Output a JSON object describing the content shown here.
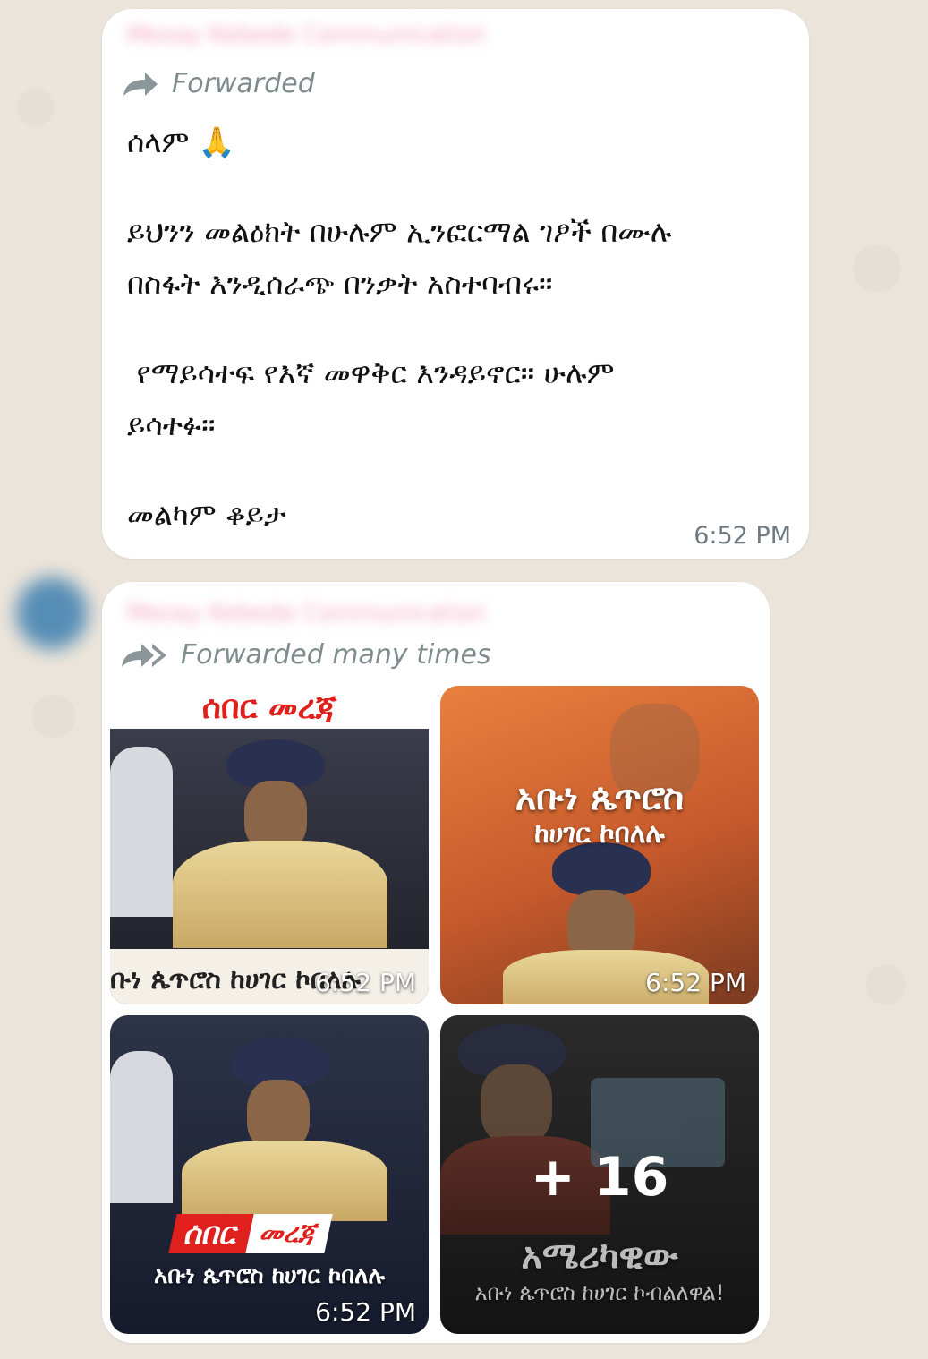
{
  "message1": {
    "sender": "Mesay Kebede Communication",
    "forwarded_label": "Forwarded",
    "greeting": "ሰላም 🙏",
    "para1_line1": "ይህንን መልዕክት በሁሉም ኢንፎርማል ገፆች በሙሉ",
    "para1_line2": "በስፋት እንዲሰራጭ በንቃት አስተባብሩ።",
    "para2_line1": " የማይሳተፍ የእኛ መዋቅር እንዳይኖር። ሁሉም",
    "para2_line2": "ይሳተፉ።",
    "closing": "መልካም ቆይታ",
    "time": "6:52 PM"
  },
  "message2": {
    "sender": "Mesay Kebede Communication",
    "forwarded_label": "Forwarded many times",
    "images": [
      {
        "headline": "ሰበር መረጃ",
        "caption": "ቡነ ጴጥሮስ ከሀገር ኮበለሉ",
        "time": "6:52 PM"
      },
      {
        "title": "አቡነ ጴጥሮስ",
        "subtitle": "ከሀገር ኮበለሉ",
        "time": "6:52 PM"
      },
      {
        "badge_left": "ሰበር",
        "badge_right": "መረጃ",
        "caption": "አቡነ ጴጥሮስ ከሀገር ኮበለሉ",
        "time": "6:52 PM"
      },
      {
        "more_count": "+ 16",
        "title": "አሜሪካዊው",
        "caption": "አቡነ ጴጥሮስ ከሀገር ኮብልለዋል!"
      }
    ]
  },
  "colors": {
    "bubble": "#ffffff",
    "background": "#ebe4da",
    "headline_red": "#e0201c",
    "meta_gray": "#7f8c8d"
  }
}
